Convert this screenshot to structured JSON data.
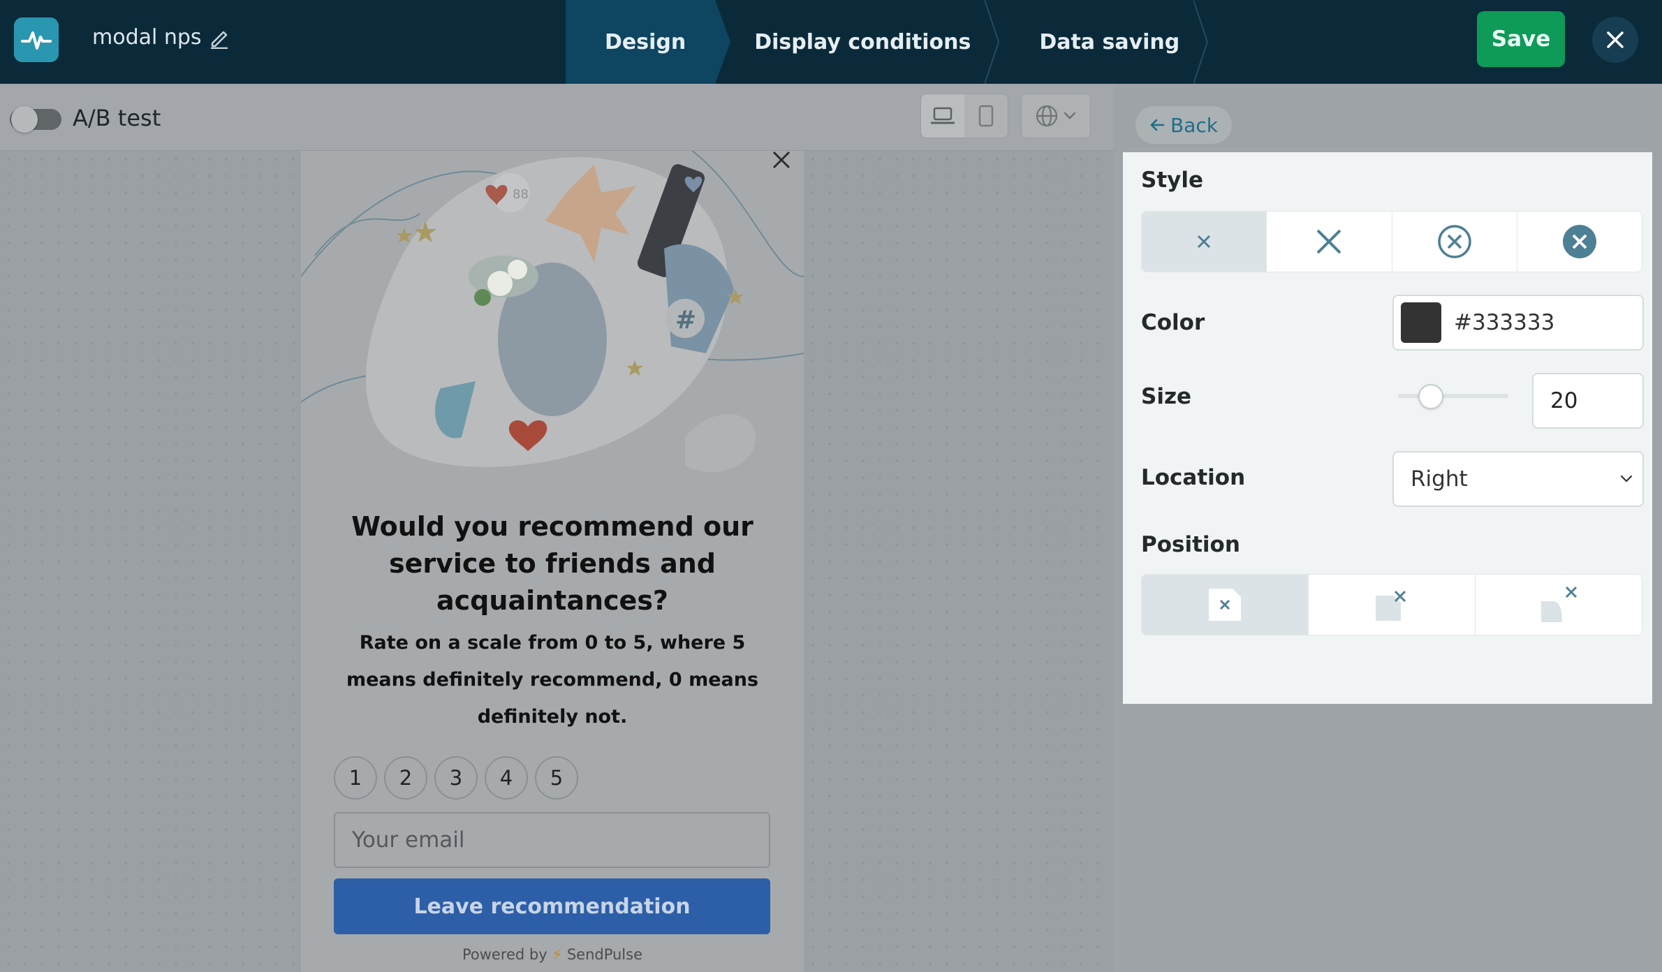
{
  "header": {
    "project_name": "modal nps",
    "steps": [
      {
        "label": "Design",
        "active": true
      },
      {
        "label": "Display conditions",
        "active": false
      },
      {
        "label": "Data saving",
        "active": false
      }
    ],
    "save_label": "Save"
  },
  "toolbar": {
    "ab_test_label": "A/B test",
    "ab_test_enabled": false,
    "device_selected": "desktop"
  },
  "popup": {
    "title": "Would you recommend our service to friends and acquaintances?",
    "subtitle": "Rate on a scale from 0 to 5, where 5 means definitely recommend, 0 means definitely not.",
    "scale": [
      "1",
      "2",
      "3",
      "4",
      "5"
    ],
    "email_placeholder": "Your email",
    "submit_label": "Leave recommendation",
    "powered_prefix": "Powered by",
    "powered_brand": "SendPulse",
    "hero_badge_count": "88",
    "hero_hashtag": "#"
  },
  "panel": {
    "back_label": "Back",
    "style_label": "Style",
    "style_options": [
      "x-small-icon",
      "x-large-icon",
      "x-circle-outline-icon",
      "x-circle-filled-icon"
    ],
    "style_selected_index": 0,
    "color_label": "Color",
    "color_value": "#333333",
    "size_label": "Size",
    "size_value": "20",
    "size_slider_fraction": 0.3,
    "location_label": "Location",
    "location_value": "Right",
    "position_label": "Position",
    "position_options": [
      "position-inside-icon",
      "position-corner-icon",
      "position-outside-icon"
    ],
    "position_selected_index": 0
  },
  "colors": {
    "topbar": "#0a2a3a",
    "save": "#0e9a58",
    "accent": "#2a97b0",
    "submit": "#2c5fa8",
    "icon": "#4d7f95"
  }
}
